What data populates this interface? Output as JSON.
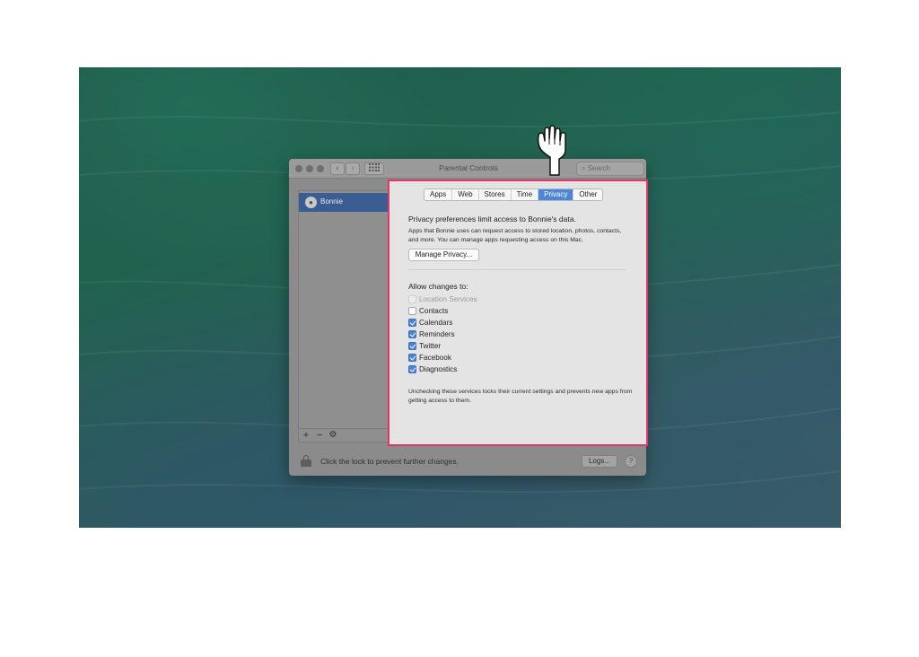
{
  "window": {
    "title": "Parental Controls",
    "nav_back": "‹",
    "nav_forward": "›",
    "grid_icon": "grid-icon",
    "search_placeholder": "Search"
  },
  "sidebar": {
    "users": [
      {
        "name": "Bonnie",
        "selected": true
      }
    ],
    "add_label": "+",
    "remove_label": "−",
    "gear_label": "⚙"
  },
  "tabs": [
    {
      "label": "Apps",
      "active": false
    },
    {
      "label": "Web",
      "active": false
    },
    {
      "label": "Stores",
      "active": false
    },
    {
      "label": "Time",
      "active": false
    },
    {
      "label": "Privacy",
      "active": true
    },
    {
      "label": "Other",
      "active": false
    }
  ],
  "privacy": {
    "heading": "Privacy preferences limit access to Bonnie's data.",
    "description": "Apps that Bonnie uses can request access to stored location, photos, contacts, and more. You can manage apps requesting access on this Mac.",
    "manage_button": "Manage Privacy...",
    "allow_label": "Allow changes to:",
    "items": [
      {
        "label": "Location Services",
        "checked": false,
        "disabled": true
      },
      {
        "label": "Contacts",
        "checked": false,
        "disabled": false
      },
      {
        "label": "Calendars",
        "checked": true,
        "disabled": false
      },
      {
        "label": "Reminders",
        "checked": true,
        "disabled": false
      },
      {
        "label": "Twitter",
        "checked": true,
        "disabled": false
      },
      {
        "label": "Facebook",
        "checked": true,
        "disabled": false
      },
      {
        "label": "Diagnostics",
        "checked": true,
        "disabled": false
      }
    ],
    "footnote": "Unchecking these services locks their current settings and prevents new apps from getting access to them."
  },
  "bottom": {
    "lock_text": "Click the lock to prevent further changes.",
    "logs_button": "Logs...",
    "help_button": "?"
  },
  "colors": {
    "highlight_border": "#e0366a",
    "tab_active": "#4d86d6",
    "checkbox_checked": "#4a83d4",
    "selected_user": "#3a5d93"
  }
}
